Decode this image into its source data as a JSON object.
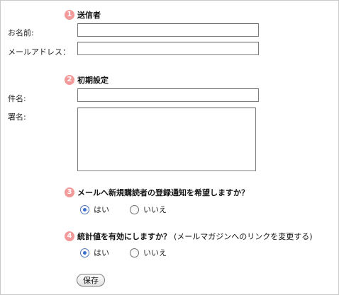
{
  "sender_section": {
    "number": "1",
    "title": "送信者"
  },
  "name_field": {
    "label": "お名前:",
    "value": ""
  },
  "email_field": {
    "label": "メールアドレス：",
    "value": ""
  },
  "initial_section": {
    "number": "2",
    "title": "初期設定"
  },
  "subject_field": {
    "label": "件名:",
    "value": ""
  },
  "signature_field": {
    "label": "署名:",
    "value": ""
  },
  "notify_section": {
    "number": "3",
    "title": "メールへ新規購読者の登録通知を希望しますか？",
    "yes_label": "はい",
    "no_label": "いいえ",
    "selected": "yes"
  },
  "stats_section": {
    "number": "4",
    "title": "統計値を有効にしますか？",
    "note": "(メールマガジンへのリンクを変更する)",
    "yes_label": "はい",
    "no_label": "いいえ",
    "selected": "yes"
  },
  "save_button": {
    "label": "保存"
  },
  "colors": {
    "badge": "#f29a9a",
    "radio_dot": "#3b6fd0"
  }
}
